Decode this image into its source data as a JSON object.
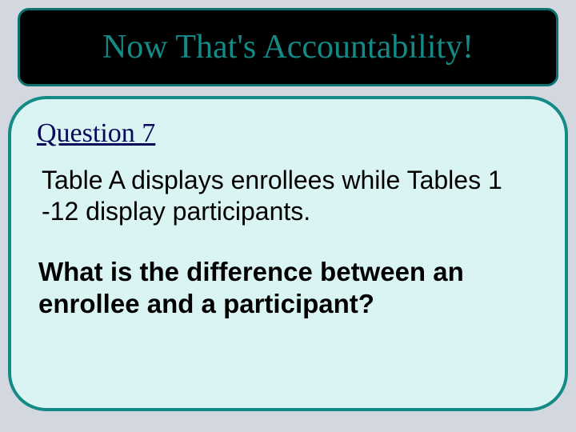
{
  "title": "Now That's Accountability!",
  "question_label": "Question 7",
  "body": "Table A displays enrollees while Tables 1 -12 display participants.",
  "question": "What is the difference between an enrollee and a participant?"
}
